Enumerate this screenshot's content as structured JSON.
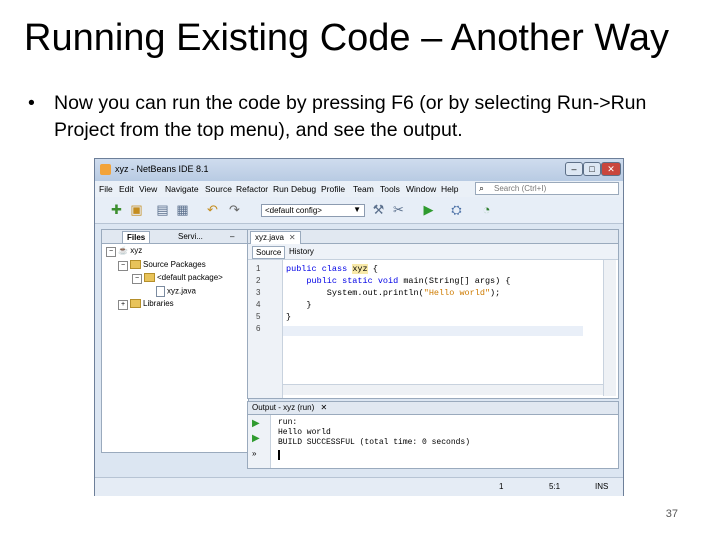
{
  "slide": {
    "title": "Running Existing Code – Another Way",
    "bullet_symbol": "•",
    "bullet": "Now you can run the code by pressing F6 (or by selecting Run->Run Project from the top menu), and see the output.",
    "page_number": "37"
  },
  "window": {
    "title": "xyz - NetBeans IDE 8.1",
    "minimize": "–",
    "maximize": "□",
    "close": "✕"
  },
  "menu": [
    "File",
    "Edit",
    "View",
    "Navigate",
    "Source",
    "Refactor",
    "Run",
    "Debug",
    "Profile",
    "Team",
    "Tools",
    "Window",
    "Help"
  ],
  "search": {
    "icon": "search-icon",
    "placeholder": "Search (Ctrl+I)"
  },
  "toolbar": {
    "config_value": "<default config>",
    "config_arrow": "▼"
  },
  "projects_panel": {
    "tabs": [
      "Files",
      "Servi..."
    ],
    "minimize": "–",
    "tree": {
      "project": "xyz",
      "source_packages": "Source Packages",
      "default_package": "<default package>",
      "file": "xyz.java",
      "libraries": "Libraries"
    }
  },
  "editor": {
    "tab": "xyz.java",
    "tab_close": "✕",
    "source_tab": "Source",
    "history_tab": "History",
    "line_numbers": [
      "1",
      "2",
      "3",
      "4",
      "5",
      "6"
    ],
    "code": {
      "l1_kw": "public class ",
      "l1_cls": "xyz",
      "l1_rest": " {",
      "l2_kw": "    public static void ",
      "l2_rest": "main(String[] args) {",
      "l3_pre": "        System.out.println(",
      "l3_str": "\"Hello world\"",
      "l3_end": ");",
      "l4": "    }",
      "l5": "}"
    }
  },
  "output": {
    "title": "Output - xyz (run)",
    "close": "✕",
    "lines": [
      "run:",
      "Hello world",
      "BUILD SUCCESSFUL (total time: 0 seconds)"
    ]
  },
  "status": {
    "notifications": "1",
    "position": "5:1",
    "mode": "INS"
  }
}
